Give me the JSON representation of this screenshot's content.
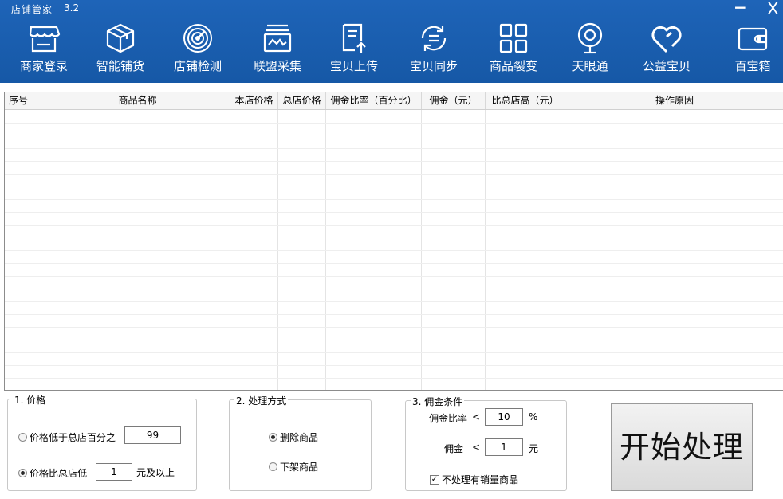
{
  "window": {
    "title": "店铺管家",
    "version": "3.2",
    "minimize_glyph": "−",
    "close_glyph": "X"
  },
  "toolbar": {
    "items": [
      {
        "label": "商家登录",
        "icon": "store-icon"
      },
      {
        "label": "智能铺货",
        "icon": "box-icon"
      },
      {
        "label": "店铺检测",
        "icon": "radar-icon"
      },
      {
        "label": "联盟采集",
        "icon": "collect-icon"
      },
      {
        "label": "宝贝上传",
        "icon": "upload-icon"
      },
      {
        "label": "宝贝同步",
        "icon": "sync-icon"
      },
      {
        "label": "商品裂变",
        "icon": "grid-icon"
      },
      {
        "label": "天眼通",
        "icon": "camera-icon"
      },
      {
        "label": "公益宝贝",
        "icon": "heart-icon"
      },
      {
        "label": "百宝箱",
        "icon": "wallet-icon"
      }
    ]
  },
  "table": {
    "columns": [
      "序号",
      "商品名称",
      "本店价格",
      "总店价格",
      "佣金比率（百分比）",
      "佣金（元）",
      "比总店高（元）",
      "操作原因"
    ],
    "rows": []
  },
  "price_group": {
    "title": "1. 价格",
    "option1_label": "价格低于总店百分之",
    "option1_value": "99",
    "option2_label": "价格比总店低",
    "option2_value": "1",
    "option2_suffix": "元及以上",
    "selected": "option2"
  },
  "handling_group": {
    "title": "2. 处理方式",
    "option1_label": "删除商品",
    "option2_label": "下架商品",
    "selected": "option1"
  },
  "commission_group": {
    "title": "3. 佣金条件",
    "rate_label": "佣金比率",
    "rate_op": "<",
    "rate_value": "10",
    "rate_unit": "%",
    "amount_label": "佣金",
    "amount_op": "<",
    "amount_value": "1",
    "amount_unit": "元",
    "skip_sold_label": "不处理有销量商品",
    "skip_sold_checked": true
  },
  "start_button": {
    "label": "开始处理"
  }
}
